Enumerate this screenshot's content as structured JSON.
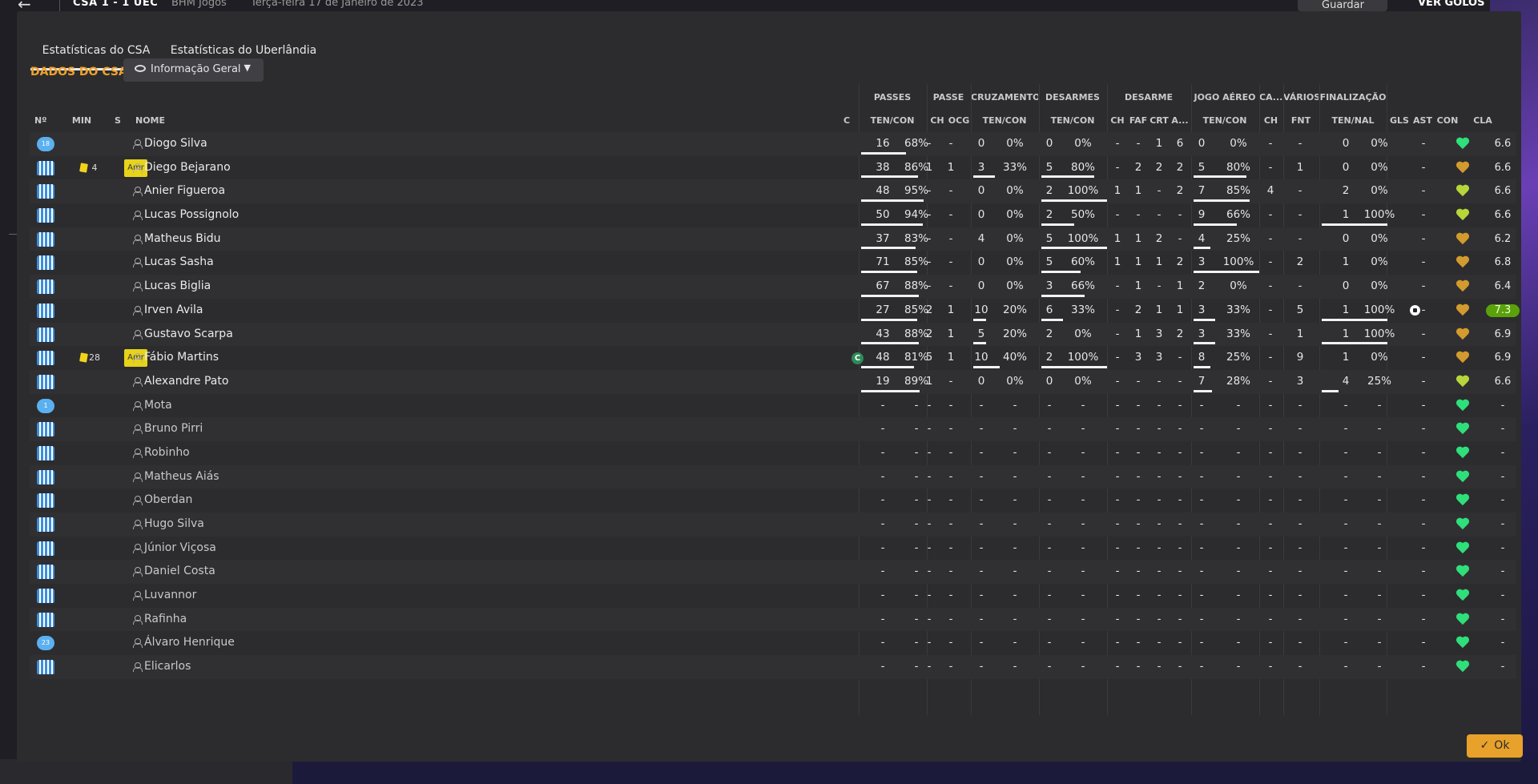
{
  "topbar": {
    "score": "CSA  1 - 1  UEC",
    "venue": "BHM Jogos",
    "date": "Terça-feira 17 de Janeiro de 2023",
    "save_label": "Guardar Jogo",
    "goals_label": "VER GOLOS"
  },
  "tabs": [
    "Estatísticas do CSA",
    "Estatísticas do Uberlândia"
  ],
  "section_title": "DADOS DO CSA",
  "view_dropdown": "Informação Geral",
  "groups": {
    "passes": "PASSES",
    "passe": "PASSE",
    "cruzamentos": "CRUZAMENTOS",
    "desarmes": "DESARMES",
    "desarme": "DESARME",
    "jogo_aereo": "JOGO AÉREO",
    "ca": "CA...",
    "varios": "VÁRIOS",
    "finalizacao": "FINALIZAÇÃO"
  },
  "headers": {
    "num": "Nº",
    "min": "MIN",
    "s": "S",
    "nome": "NOME",
    "c": "C",
    "ten_con": "TEN/CON",
    "ch": "CH",
    "ocg": "OCG",
    "faf": "FAF",
    "crt": "CRT",
    "a": "A...",
    "fnt": "FNT",
    "ten_nal": "TEN/NAL",
    "gls": "GLS",
    "ast": "AST",
    "con": "CON",
    "cla": "CLA"
  },
  "players": [
    {
      "num": "18",
      "gk": true,
      "min": "",
      "card": false,
      "pos": "",
      "name": "Diogo Silva",
      "cap": false,
      "pa_t": "16",
      "pa_p": "68%",
      "pa_b": 0.68,
      "p_ch": "-",
      "p_ocg": "-",
      "cr_t": "0",
      "cr_p": "0%",
      "cr_b": 0,
      "de_t": "0",
      "de_p": "0%",
      "de_b": 0,
      "d_ch": "-",
      "d_faf": "-",
      "d_crt": "1",
      "d_a": "6",
      "ja_t": "0",
      "ja_p": "0%",
      "ja_b": 0,
      "ca": "-",
      "fnt": "-",
      "fi_t": "0",
      "fi_p": "0%",
      "fi_b": 0,
      "gls": "",
      "goal": false,
      "ast": "-",
      "con": "green",
      "cla": "6.6",
      "best": false,
      "sub": false
    },
    {
      "num": "",
      "gk": false,
      "min": "4",
      "card": true,
      "pos": "Amr",
      "name": "Diego Bejarano",
      "cap": false,
      "pa_t": "38",
      "pa_p": "86%",
      "pa_b": 0.86,
      "p_ch": "1",
      "p_ocg": "1",
      "cr_t": "3",
      "cr_p": "33%",
      "cr_b": 0.33,
      "de_t": "5",
      "de_p": "80%",
      "de_b": 0.8,
      "d_ch": "-",
      "d_faf": "2",
      "d_crt": "2",
      "d_a": "2",
      "ja_t": "5",
      "ja_p": "80%",
      "ja_b": 0.8,
      "ca": "-",
      "fnt": "1",
      "fi_t": "0",
      "fi_p": "0%",
      "fi_b": 0,
      "gls": "",
      "goal": false,
      "ast": "-",
      "con": "amber",
      "cla": "6.6",
      "best": false,
      "sub": false
    },
    {
      "num": "",
      "gk": false,
      "min": "",
      "card": false,
      "pos": "",
      "name": "Anier Figueroa",
      "cap": false,
      "pa_t": "48",
      "pa_p": "95%",
      "pa_b": 0.95,
      "p_ch": "-",
      "p_ocg": "-",
      "cr_t": "0",
      "cr_p": "0%",
      "cr_b": 0,
      "de_t": "2",
      "de_p": "100%",
      "de_b": 1,
      "d_ch": "1",
      "d_faf": "1",
      "d_crt": "-",
      "d_a": "2",
      "ja_t": "7",
      "ja_p": "85%",
      "ja_b": 0.85,
      "ca": "4",
      "fnt": "-",
      "fi_t": "2",
      "fi_p": "0%",
      "fi_b": 0,
      "gls": "",
      "goal": false,
      "ast": "-",
      "con": "lime",
      "cla": "6.6",
      "best": false,
      "sub": false
    },
    {
      "num": "",
      "gk": false,
      "min": "",
      "card": false,
      "pos": "",
      "name": "Lucas Possignolo",
      "cap": false,
      "pa_t": "50",
      "pa_p": "94%",
      "pa_b": 0.94,
      "p_ch": "-",
      "p_ocg": "-",
      "cr_t": "0",
      "cr_p": "0%",
      "cr_b": 0,
      "de_t": "2",
      "de_p": "50%",
      "de_b": 0.5,
      "d_ch": "-",
      "d_faf": "-",
      "d_crt": "-",
      "d_a": "-",
      "ja_t": "9",
      "ja_p": "66%",
      "ja_b": 0.66,
      "ca": "-",
      "fnt": "-",
      "fi_t": "1",
      "fi_p": "100%",
      "fi_b": 1,
      "gls": "",
      "goal": false,
      "ast": "-",
      "con": "lime",
      "cla": "6.6",
      "best": false,
      "sub": false
    },
    {
      "num": "",
      "gk": false,
      "min": "",
      "card": false,
      "pos": "",
      "name": "Matheus Bidu",
      "cap": false,
      "pa_t": "37",
      "pa_p": "83%",
      "pa_b": 0.83,
      "p_ch": "-",
      "p_ocg": "-",
      "cr_t": "4",
      "cr_p": "0%",
      "cr_b": 0,
      "de_t": "5",
      "de_p": "100%",
      "de_b": 1,
      "d_ch": "1",
      "d_faf": "1",
      "d_crt": "2",
      "d_a": "-",
      "ja_t": "4",
      "ja_p": "25%",
      "ja_b": 0.25,
      "ca": "-",
      "fnt": "-",
      "fi_t": "0",
      "fi_p": "0%",
      "fi_b": 0,
      "gls": "",
      "goal": false,
      "ast": "-",
      "con": "amber",
      "cla": "6.2",
      "best": false,
      "sub": false
    },
    {
      "num": "",
      "gk": false,
      "min": "",
      "card": false,
      "pos": "",
      "name": "Lucas Sasha",
      "cap": false,
      "pa_t": "71",
      "pa_p": "85%",
      "pa_b": 0.85,
      "p_ch": "-",
      "p_ocg": "-",
      "cr_t": "0",
      "cr_p": "0%",
      "cr_b": 0,
      "de_t": "5",
      "de_p": "60%",
      "de_b": 0.6,
      "d_ch": "1",
      "d_faf": "1",
      "d_crt": "1",
      "d_a": "2",
      "ja_t": "3",
      "ja_p": "100%",
      "ja_b": 1,
      "ca": "-",
      "fnt": "2",
      "fi_t": "1",
      "fi_p": "0%",
      "fi_b": 0,
      "gls": "",
      "goal": false,
      "ast": "-",
      "con": "amber",
      "cla": "6.8",
      "best": false,
      "sub": false
    },
    {
      "num": "",
      "gk": false,
      "min": "",
      "card": false,
      "pos": "",
      "name": "Lucas Biglia",
      "cap": false,
      "pa_t": "67",
      "pa_p": "88%",
      "pa_b": 0.88,
      "p_ch": "-",
      "p_ocg": "-",
      "cr_t": "0",
      "cr_p": "0%",
      "cr_b": 0,
      "de_t": "3",
      "de_p": "66%",
      "de_b": 0.66,
      "d_ch": "-",
      "d_faf": "1",
      "d_crt": "-",
      "d_a": "1",
      "ja_t": "2",
      "ja_p": "0%",
      "ja_b": 0,
      "ca": "-",
      "fnt": "-",
      "fi_t": "0",
      "fi_p": "0%",
      "fi_b": 0,
      "gls": "",
      "goal": false,
      "ast": "-",
      "con": "amber",
      "cla": "6.4",
      "best": false,
      "sub": false
    },
    {
      "num": "",
      "gk": false,
      "min": "",
      "card": false,
      "pos": "",
      "name": "Irven Avila",
      "cap": false,
      "pa_t": "27",
      "pa_p": "85%",
      "pa_b": 0.85,
      "p_ch": "2",
      "p_ocg": "1",
      "cr_t": "10",
      "cr_p": "20%",
      "cr_b": 0.2,
      "de_t": "6",
      "de_p": "33%",
      "de_b": 0.33,
      "d_ch": "-",
      "d_faf": "2",
      "d_crt": "1",
      "d_a": "1",
      "ja_t": "3",
      "ja_p": "33%",
      "ja_b": 0.33,
      "ca": "-",
      "fnt": "5",
      "fi_t": "1",
      "fi_p": "100%",
      "fi_b": 1,
      "gls": "",
      "goal": true,
      "ast": "-",
      "con": "amber",
      "cla": "7.3",
      "best": true,
      "sub": false
    },
    {
      "num": "",
      "gk": false,
      "min": "",
      "card": false,
      "pos": "",
      "name": "Gustavo Scarpa",
      "cap": false,
      "pa_t": "43",
      "pa_p": "88%",
      "pa_b": 0.88,
      "p_ch": "2",
      "p_ocg": "1",
      "cr_t": "5",
      "cr_p": "20%",
      "cr_b": 0.2,
      "de_t": "2",
      "de_p": "0%",
      "de_b": 0,
      "d_ch": "-",
      "d_faf": "1",
      "d_crt": "3",
      "d_a": "2",
      "ja_t": "3",
      "ja_p": "33%",
      "ja_b": 0.33,
      "ca": "-",
      "fnt": "1",
      "fi_t": "1",
      "fi_p": "100%",
      "fi_b": 1,
      "gls": "",
      "goal": false,
      "ast": "-",
      "con": "amber",
      "cla": "6.9",
      "best": false,
      "sub": false
    },
    {
      "num": "",
      "gk": false,
      "min": "28",
      "card": true,
      "pos": "Amr",
      "name": "Fábio Martins",
      "cap": true,
      "pa_t": "48",
      "pa_p": "81%",
      "pa_b": 0.81,
      "p_ch": "5",
      "p_ocg": "1",
      "cr_t": "10",
      "cr_p": "40%",
      "cr_b": 0.4,
      "de_t": "2",
      "de_p": "100%",
      "de_b": 1,
      "d_ch": "-",
      "d_faf": "3",
      "d_crt": "3",
      "d_a": "-",
      "ja_t": "8",
      "ja_p": "25%",
      "ja_b": 0.25,
      "ca": "-",
      "fnt": "9",
      "fi_t": "1",
      "fi_p": "0%",
      "fi_b": 0,
      "gls": "",
      "goal": false,
      "ast": "-",
      "con": "amber",
      "cla": "6.9",
      "best": false,
      "sub": false
    },
    {
      "num": "",
      "gk": false,
      "min": "",
      "card": false,
      "pos": "",
      "name": "Alexandre Pato",
      "cap": false,
      "pa_t": "19",
      "pa_p": "89%",
      "pa_b": 0.89,
      "p_ch": "1",
      "p_ocg": "-",
      "cr_t": "0",
      "cr_p": "0%",
      "cr_b": 0,
      "de_t": "0",
      "de_p": "0%",
      "de_b": 0,
      "d_ch": "-",
      "d_faf": "-",
      "d_crt": "-",
      "d_a": "-",
      "ja_t": "7",
      "ja_p": "28%",
      "ja_b": 0.28,
      "ca": "-",
      "fnt": "3",
      "fi_t": "4",
      "fi_p": "25%",
      "fi_b": 0.25,
      "gls": "",
      "goal": false,
      "ast": "-",
      "con": "lime",
      "cla": "6.6",
      "best": false,
      "sub": false
    },
    {
      "num": "1",
      "gk": true,
      "sub": true,
      "name": "Mota"
    },
    {
      "num": "",
      "gk": false,
      "sub": true,
      "name": "Bruno Pirri"
    },
    {
      "num": "",
      "gk": false,
      "sub": true,
      "name": "Robinho"
    },
    {
      "num": "",
      "gk": false,
      "sub": true,
      "name": "Matheus Aiás"
    },
    {
      "num": "",
      "gk": false,
      "sub": true,
      "name": "Oberdan"
    },
    {
      "num": "",
      "gk": false,
      "sub": true,
      "name": "Hugo Silva"
    },
    {
      "num": "",
      "gk": false,
      "sub": true,
      "name": "Júnior Viçosa"
    },
    {
      "num": "",
      "gk": false,
      "sub": true,
      "name": "Daniel Costa"
    },
    {
      "num": "",
      "gk": false,
      "sub": true,
      "name": "Luvannor"
    },
    {
      "num": "",
      "gk": false,
      "sub": true,
      "name": "Rafinha"
    },
    {
      "num": "23",
      "gk": true,
      "sub": true,
      "name": "Álvaro Henrique"
    },
    {
      "num": "",
      "gk": false,
      "sub": true,
      "name": "Elicarlos"
    }
  ],
  "dash": "-",
  "ok_label": "Ok",
  "colors": {
    "accent": "#f0a12a",
    "best_rating": "#5aa10b",
    "yellow_card": "#f2d31c",
    "morale_good": "#2fdf7a"
  }
}
